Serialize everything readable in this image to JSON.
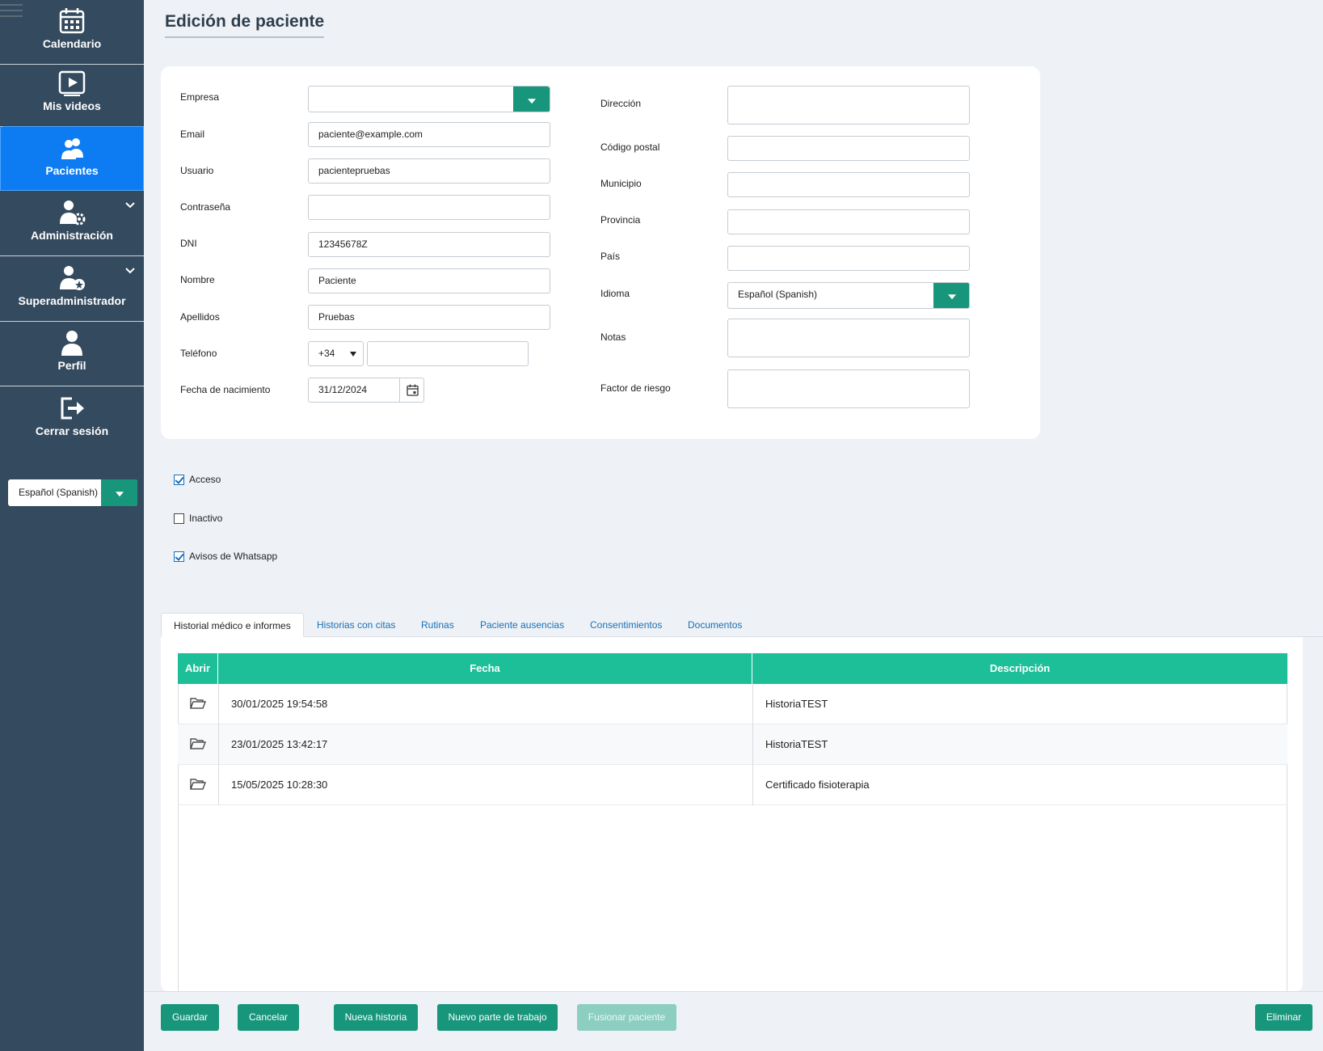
{
  "sidebar": {
    "items": [
      {
        "label": "Calendario",
        "icon": "calendar-icon"
      },
      {
        "label": "Mis videos",
        "icon": "video-icon"
      },
      {
        "label": "Pacientes",
        "icon": "patients-icon"
      },
      {
        "label": "Administración",
        "icon": "admin-icon"
      },
      {
        "label": "Superadministrador",
        "icon": "superadmin-icon"
      },
      {
        "label": "Perfil",
        "icon": "profile-icon"
      },
      {
        "label": "Cerrar sesión",
        "icon": "logout-icon"
      }
    ],
    "language": "Español (Spanish)"
  },
  "page": {
    "title": "Edición de paciente"
  },
  "form": {
    "empresa": {
      "label": "Empresa",
      "value": ""
    },
    "email": {
      "label": "Email",
      "value": "paciente@example.com"
    },
    "usuario": {
      "label": "Usuario",
      "value": "pacientepruebas"
    },
    "contrasena": {
      "label": "Contraseña",
      "value": ""
    },
    "dni": {
      "label": "DNI",
      "value": "12345678Z"
    },
    "nombre": {
      "label": "Nombre",
      "value": "Paciente"
    },
    "apellidos": {
      "label": "Apellidos",
      "value": "Pruebas"
    },
    "telefono": {
      "label": "Teléfono",
      "prefix": "+34",
      "value": ""
    },
    "fecha_nacimiento": {
      "label": "Fecha de nacimiento",
      "value": "31/12/2024"
    },
    "direccion": {
      "label": "Dirección",
      "value": ""
    },
    "codigo_postal": {
      "label": "Código postal",
      "value": ""
    },
    "municipio": {
      "label": "Municipio",
      "value": ""
    },
    "provincia": {
      "label": "Provincia",
      "value": ""
    },
    "pais": {
      "label": "País",
      "value": ""
    },
    "idioma": {
      "label": "Idioma",
      "value": "Español (Spanish)"
    },
    "notas": {
      "label": "Notas",
      "value": ""
    },
    "factor_riesgo": {
      "label": "Factor de riesgo",
      "value": ""
    }
  },
  "checkboxes": [
    {
      "label": "Acceso",
      "checked": true
    },
    {
      "label": "Inactivo",
      "checked": false
    },
    {
      "label": "Avisos de Whatsapp",
      "checked": true
    }
  ],
  "tabs": [
    {
      "label": "Historial médico e informes",
      "active": true
    },
    {
      "label": "Historias con citas",
      "active": false
    },
    {
      "label": "Rutinas",
      "active": false
    },
    {
      "label": "Paciente ausencias",
      "active": false
    },
    {
      "label": "Consentimientos",
      "active": false
    },
    {
      "label": "Documentos",
      "active": false
    }
  ],
  "table": {
    "columns": [
      "Abrir",
      "Fecha",
      "Descripción"
    ],
    "rows": [
      {
        "fecha": "30/01/2025 19:54:58",
        "descripcion": "HistoriaTEST"
      },
      {
        "fecha": "23/01/2025 13:42:17",
        "descripcion": "HistoriaTEST"
      },
      {
        "fecha": "15/05/2025 10:28:30",
        "descripcion": "Certificado fisioterapia"
      }
    ]
  },
  "actions": {
    "guardar": "Guardar",
    "cancelar": "Cancelar",
    "nueva_historia": "Nueva historia",
    "nuevo_parte": "Nuevo parte de trabajo",
    "fusionar": "Fusionar paciente",
    "eliminar": "Eliminar"
  },
  "colors": {
    "sidebar": "#344a5e",
    "active_nav": "#0d7cf2",
    "accent": "#17967c",
    "table_header": "#1dbf99"
  }
}
